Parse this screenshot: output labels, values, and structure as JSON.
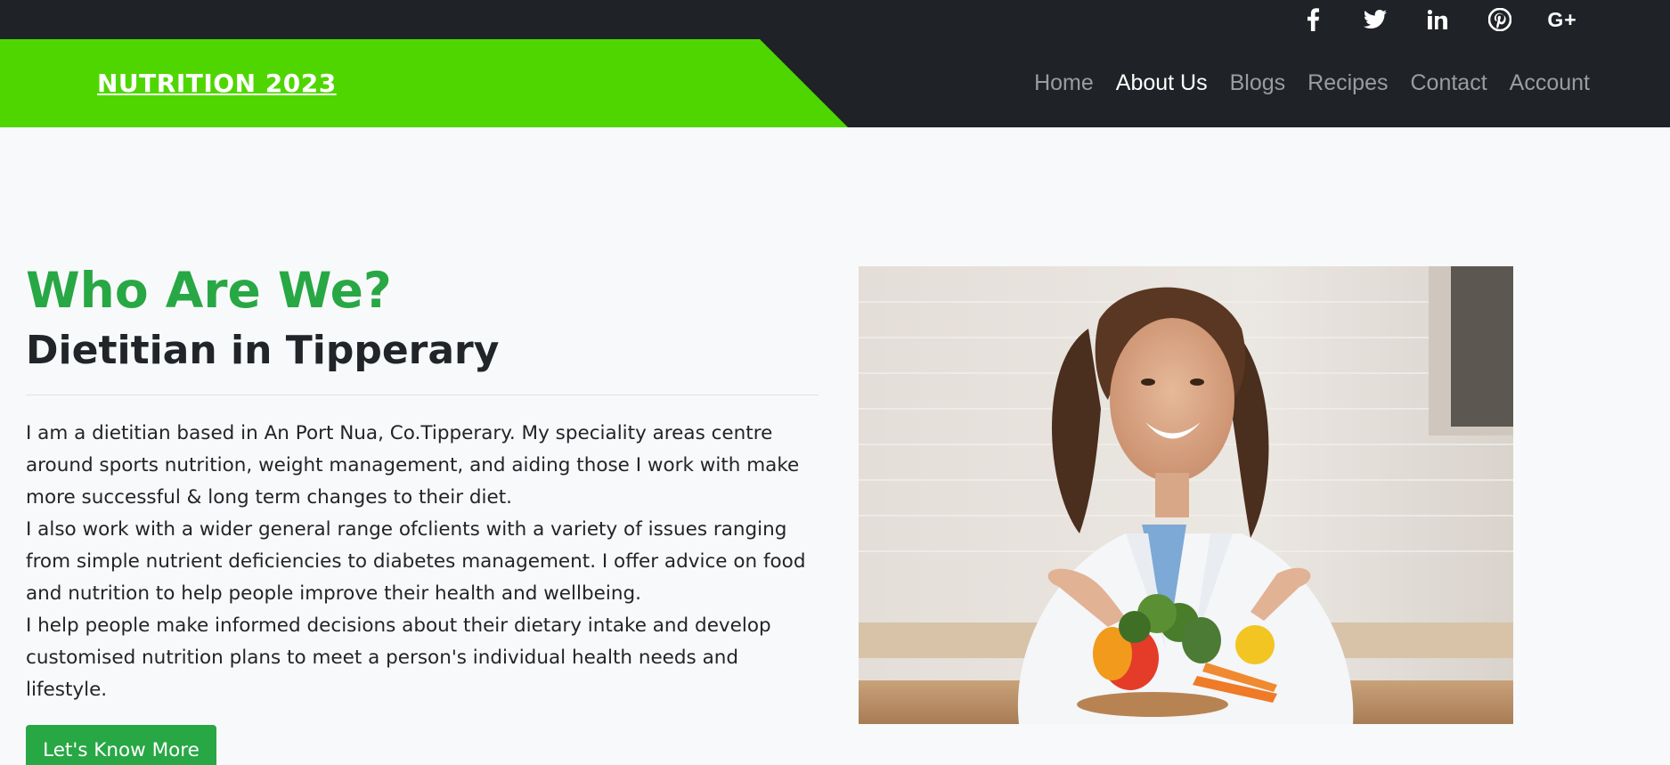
{
  "topbar": {
    "social": [
      {
        "name": "facebook-icon",
        "glyph": "f"
      },
      {
        "name": "twitter-icon",
        "glyph": ""
      },
      {
        "name": "linkedin-icon",
        "glyph": "in"
      },
      {
        "name": "pinterest-icon",
        "glyph": ""
      },
      {
        "name": "google-plus-icon",
        "glyph": "G+"
      }
    ]
  },
  "header": {
    "brand": "NUTRITION 2023",
    "nav": [
      "Home",
      "About Us",
      "Blogs",
      "Recipes",
      "Contact",
      "Account"
    ],
    "active_nav": "About Us"
  },
  "main": {
    "kicker": "Who Are We?",
    "subtitle": "Dietitian in Tipperary",
    "paragraphs": [
      "I am a dietitian based in An Port Nua, Co.Tipperary. My speciality areas centre around sports nutrition, weight management, and aiding those I work with make more successful & long term changes to their diet.",
      "I also work with a wider general range ofclients with a variety of issues ranging from simple nutrient deficiencies to diabetes management. I offer advice on food and nutrition to help people improve their health and wellbeing.",
      "I help people make informed decisions about their dietary intake and develop customised nutrition plans to meet a person's individual health needs and lifestyle."
    ],
    "cta_label": "Let's Know More"
  },
  "colors": {
    "brand_green": "#4fd600",
    "accent_green": "#28a745",
    "dark": "#1f2226",
    "page_bg": "#f8f9fa"
  }
}
